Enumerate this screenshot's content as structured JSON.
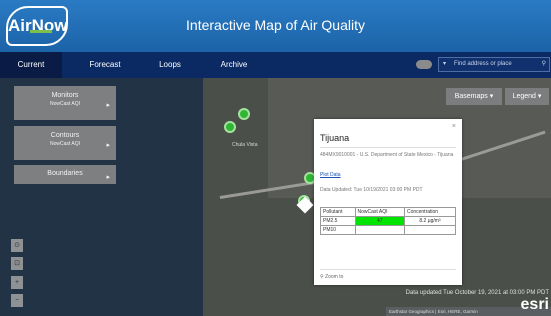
{
  "header": {
    "logo_text": "AirNow",
    "title": "Interactive Map of Air Quality"
  },
  "nav": {
    "tabs": [
      {
        "label": "Current",
        "active": true
      },
      {
        "label": "Forecast",
        "active": false
      },
      {
        "label": "Loops",
        "active": false
      },
      {
        "label": "Archive",
        "active": false
      }
    ],
    "search_placeholder": "Find address or place"
  },
  "left_panel": {
    "monitors": {
      "title": "Monitors",
      "subtitle": "NowCast AQI"
    },
    "contours": {
      "title": "Contours",
      "subtitle": "NowCast AQI"
    },
    "boundaries": {
      "title": "Boundaries"
    }
  },
  "map_controls": {
    "basemaps_label": "Basemaps",
    "legend_label": "Legend"
  },
  "zoom_controls": [
    "⊙",
    "⊡",
    "+",
    "−"
  ],
  "map_labels": {
    "chula_vista": "Chula Vista"
  },
  "popup": {
    "close": "×",
    "site_name": "Tijuana",
    "agency": "484MX9010001 - U.S. Department of State Mexico - Tijuana",
    "plot_link": "Plot Data",
    "updated": "Data Updated: Tue 10/19/2021 03:00 PM PDT",
    "table": {
      "headers": [
        "Pollutant",
        "NowCast AQI",
        "Concentration"
      ],
      "rows": [
        {
          "pollutant": "PM2.5",
          "aqi": "47",
          "concentration": "8.2 µg/m³"
        },
        {
          "pollutant": "PM10",
          "aqi": "",
          "concentration": ""
        }
      ]
    },
    "zoom_to": "Zoom to"
  },
  "footer": {
    "data_updated": "Data updated Tue October 19, 2021 at 03:00 PM PDT",
    "attribution": "Earthstar Geographics | Esri, HERE, Garmin",
    "esri": "esri"
  },
  "colors": {
    "header": "#1c63a8",
    "nav": "#0b2a63",
    "aqi_good": "#00e400",
    "marker": "#2fb635"
  }
}
